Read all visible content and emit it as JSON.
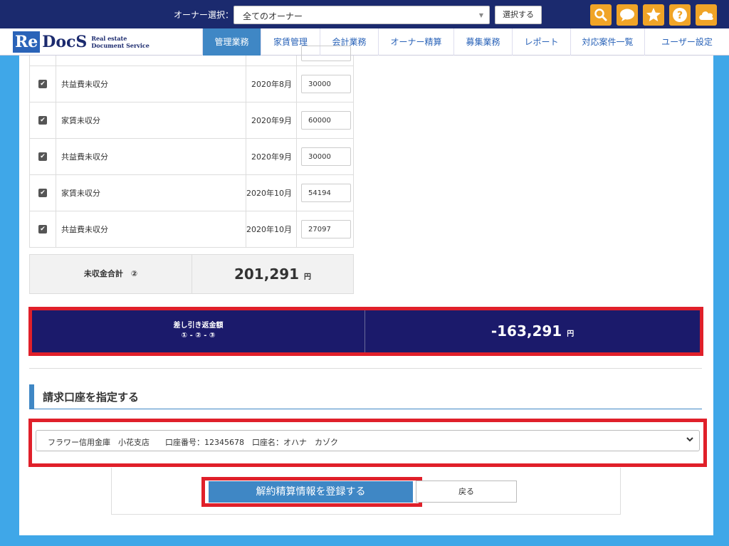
{
  "header": {
    "owner_label": "オーナー選択：",
    "owner_value": "全てのオーナー",
    "select_button": "選択する",
    "icons": [
      "search-icon",
      "chat-icon",
      "star-icon",
      "help-icon",
      "cloud-icon"
    ],
    "accent_color": "#f0a427"
  },
  "nav": {
    "logo_re": "Re",
    "logo_docs": "DocS",
    "logo_sub1": "Real estate",
    "logo_sub2": "Document Service",
    "tabs": [
      "管理業務",
      "家賃管理",
      "会計業務",
      "オーナー精算",
      "募集業務",
      "レポート",
      "対応案件一覧",
      "ユーザー設定"
    ],
    "active_tab": "管理業務"
  },
  "table": {
    "rows": [
      {
        "name": "共益費未収分",
        "month": "2020年8月",
        "amount": "30000",
        "checked": true
      },
      {
        "name": "家賃未収分",
        "month": "2020年9月",
        "amount": "60000",
        "checked": true
      },
      {
        "name": "共益費未収分",
        "month": "2020年9月",
        "amount": "30000",
        "checked": true
      },
      {
        "name": "家賃未収分",
        "month": "2020年10月",
        "amount": "54194",
        "checked": true
      },
      {
        "name": "共益費未収分",
        "month": "2020年10月",
        "amount": "27097",
        "checked": true
      }
    ]
  },
  "summary": {
    "label": "未収金合計　②",
    "value": "201,291",
    "unit": "円"
  },
  "difference": {
    "label": "差し引き返金額",
    "formula": "① - ② - ③",
    "value": "-163,291",
    "unit": "円"
  },
  "account": {
    "heading": "請求口座を指定する",
    "selected": "フラワー信用金庫　小花支店　　口座番号：12345678　口座名：オハナ　カゾク"
  },
  "actions": {
    "submit": "解約精算情報を登録する",
    "back": "戻る"
  },
  "colors": {
    "navy": "#1b2a6e",
    "highlight": "#e0202a",
    "primary": "#3f87c5",
    "background": "#3fa7e8"
  }
}
